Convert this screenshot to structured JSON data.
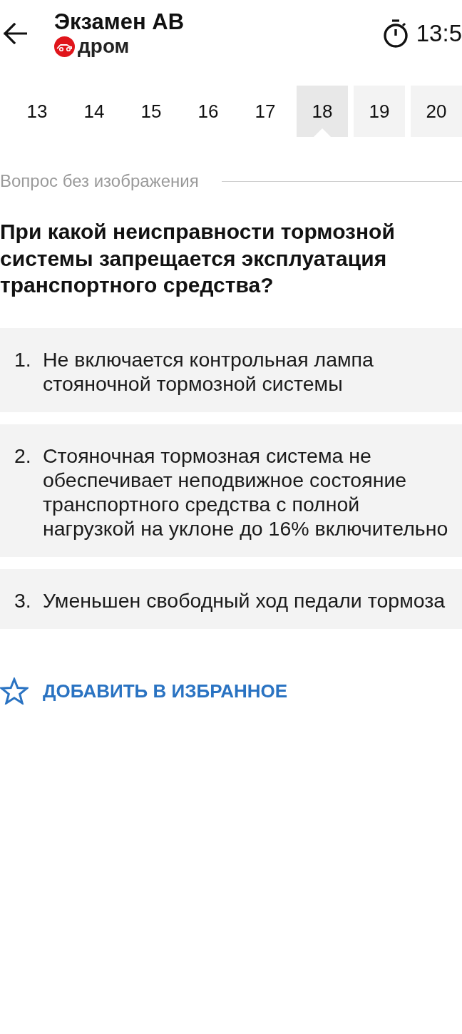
{
  "header": {
    "title": "Экзамен АВ",
    "brand": "дром",
    "timer": "13:5"
  },
  "question_tabs": [
    {
      "label": "13",
      "selected": false,
      "answered": true
    },
    {
      "label": "14",
      "selected": false,
      "answered": true
    },
    {
      "label": "15",
      "selected": false,
      "answered": true
    },
    {
      "label": "16",
      "selected": false,
      "answered": true
    },
    {
      "label": "17",
      "selected": false,
      "answered": true
    },
    {
      "label": "18",
      "selected": true,
      "answered": false
    },
    {
      "label": "19",
      "selected": false,
      "answered": false
    },
    {
      "label": "20",
      "selected": false,
      "answered": false
    }
  ],
  "question_meta": {
    "label": "Вопрос без изображения"
  },
  "question": "При какой неисправности тормозной системы запрещается эксплуатация транспортного средства?",
  "answers": [
    {
      "number": "1.",
      "text": "Не включается контрольная лампа стояночной тормозной системы"
    },
    {
      "number": "2.",
      "text": "Стояночная тормозная система не обеспечивает неподвижное состояние транспортного средства с полной нагрузкой на уклоне до 16% включительно"
    },
    {
      "number": "3.",
      "text": "Уменьшен свободный ход педали тормоза"
    }
  ],
  "favorite_button": {
    "label": "ДОБАВИТЬ В ИЗБРАННОЕ"
  }
}
